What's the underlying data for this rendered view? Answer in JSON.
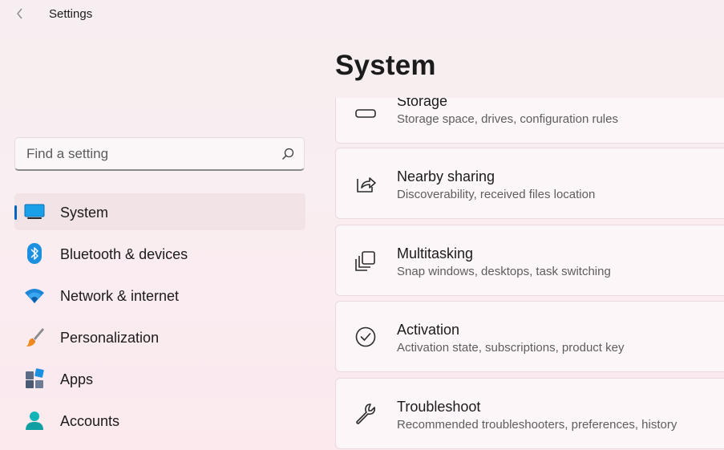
{
  "app": {
    "title": "Settings"
  },
  "search": {
    "placeholder": "Find a setting"
  },
  "nav": {
    "items": [
      {
        "label": "System",
        "icon": "system-icon",
        "active": true
      },
      {
        "label": "Bluetooth & devices",
        "icon": "bluetooth-icon"
      },
      {
        "label": "Network & internet",
        "icon": "wifi-icon"
      },
      {
        "label": "Personalization",
        "icon": "brush-icon"
      },
      {
        "label": "Apps",
        "icon": "apps-icon"
      },
      {
        "label": "Accounts",
        "icon": "accounts-icon"
      }
    ]
  },
  "page": {
    "title": "System"
  },
  "cards": [
    {
      "title": "Storage",
      "subtitle": "Storage space, drives, configuration rules",
      "icon": "storage-icon"
    },
    {
      "title": "Nearby sharing",
      "subtitle": "Discoverability, received files location",
      "icon": "share-icon"
    },
    {
      "title": "Multitasking",
      "subtitle": "Snap windows, desktops, task switching",
      "icon": "multitasking-icon"
    },
    {
      "title": "Activation",
      "subtitle": "Activation state, subscriptions, product key",
      "icon": "activation-icon"
    },
    {
      "title": "Troubleshoot",
      "subtitle": "Recommended troubleshooters, preferences, history",
      "icon": "wrench-icon"
    }
  ],
  "colors": {
    "accent": "#0067c0",
    "background": "#f8eef1"
  }
}
